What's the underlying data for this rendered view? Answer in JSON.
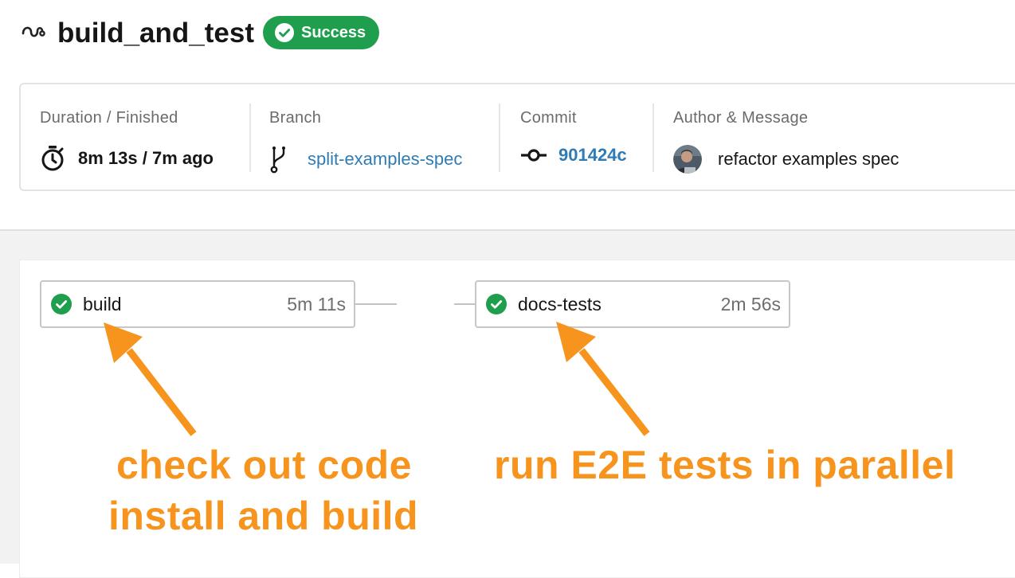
{
  "workflow": {
    "name": "build_and_test",
    "status": "Success",
    "icon": "workflow-icon"
  },
  "info": {
    "duration": {
      "label": "Duration / Finished",
      "value": "8m 13s / 7m ago",
      "icon": "stopwatch-icon"
    },
    "branch": {
      "label": "Branch",
      "value": "split-examples-spec",
      "icon": "git-branch-icon"
    },
    "commit": {
      "label": "Commit",
      "value": "901424c",
      "icon": "git-commit-icon"
    },
    "author": {
      "label": "Author & Message",
      "message": "refactor examples spec",
      "icon": "avatar"
    }
  },
  "jobs": [
    {
      "name": "build",
      "duration": "5m 11s",
      "status": "success"
    },
    {
      "name": "docs-tests",
      "duration": "2m 56s",
      "status": "success"
    }
  ],
  "annotations": {
    "left_line1": "check out code",
    "left_line2": "install and build",
    "right_line1": "run E2E tests in parallel"
  },
  "colors": {
    "success": "#1f9f4d",
    "link": "#2f7bb5",
    "annotation": "#f7941d"
  }
}
